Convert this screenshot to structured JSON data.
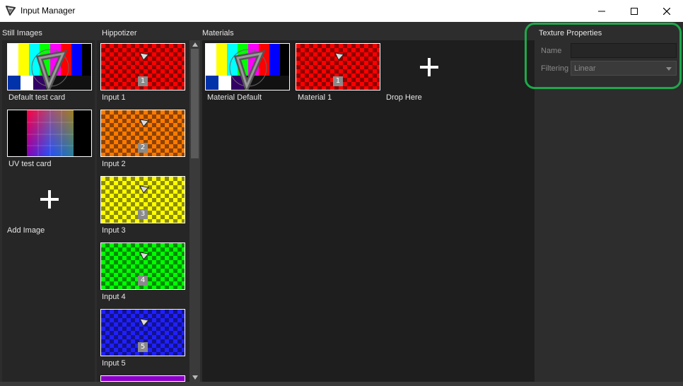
{
  "window": {
    "title": "Input Manager"
  },
  "columns": {
    "still_images": {
      "label": "Still Images",
      "items": [
        {
          "label": "Default test card"
        },
        {
          "label": "UV test card"
        }
      ],
      "add_label": "Add Image"
    },
    "hippotizer": {
      "label": "Hippotizer",
      "items": [
        {
          "label": "Input 1",
          "number": "1",
          "color": "#ff0000"
        },
        {
          "label": "Input 2",
          "number": "2",
          "color": "#ff7a00"
        },
        {
          "label": "Input 3",
          "number": "3",
          "color": "#ffff00"
        },
        {
          "label": "Input 4",
          "number": "4",
          "color": "#00ff00"
        },
        {
          "label": "Input 5",
          "number": "5",
          "color": "#2020ff"
        }
      ]
    },
    "materials": {
      "label": "Materials",
      "items": [
        {
          "label": "Material Default"
        },
        {
          "label": "Material 1",
          "number": "1",
          "color": "#ff0000"
        }
      ],
      "drop_label": "Drop Here"
    }
  },
  "texture_properties": {
    "title": "Texture Properties",
    "name_label": "Name",
    "name_value": "",
    "filtering_label": "Filtering",
    "filtering_value": "Linear"
  },
  "colors": {
    "highlight": "#1fa84a"
  }
}
